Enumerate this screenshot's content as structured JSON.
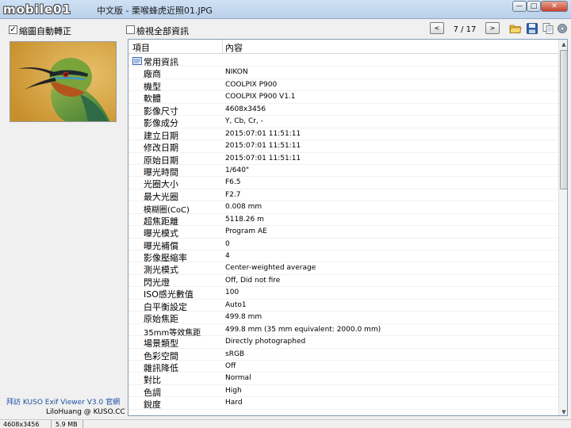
{
  "title_bar": {
    "logo_text": "mobile01",
    "window_title": "中文版 - 栗喉蜂虎近照01.JPG",
    "minimize_glyph": "—",
    "maximize_glyph": "□",
    "close_glyph": "✕"
  },
  "toolbar": {
    "auto_rotate_label": "縮圖自動轉正",
    "auto_rotate_checked": true,
    "check_glyph": "✓",
    "show_all_label": "檢視全部資訊",
    "show_all_checked": false,
    "prev_glyph": "<",
    "next_glyph": ">",
    "page_indicator": "7 / 17",
    "icons": [
      "folder-open-icon",
      "save-icon",
      "copy-icon",
      "settings-icon"
    ]
  },
  "table": {
    "headers": {
      "item": "項目",
      "value": "內容"
    },
    "group_label": "常用資訊",
    "rows": [
      {
        "key": "廠商",
        "value": "NIKON"
      },
      {
        "key": "機型",
        "value": "COOLPIX P900"
      },
      {
        "key": "軟體",
        "value": "COOLPIX P900   V1.1"
      },
      {
        "key": "影像尺寸",
        "value": "4608x3456"
      },
      {
        "key": "影像成分",
        "value": "Y, Cb, Cr, -"
      },
      {
        "key": "建立日期",
        "value": "2015:07:01 11:51:11"
      },
      {
        "key": "修改日期",
        "value": "2015:07:01 11:51:11"
      },
      {
        "key": "原始日期",
        "value": "2015:07:01 11:51:11"
      },
      {
        "key": "曝光時間",
        "value": "1/640\""
      },
      {
        "key": "光圈大小",
        "value": "F6.5"
      },
      {
        "key": "最大光圈",
        "value": "F2.7"
      },
      {
        "key": "模糊圈(CoC)",
        "value": "0.008 mm"
      },
      {
        "key": "超焦距離",
        "value": "5118.26 m"
      },
      {
        "key": "曝光模式",
        "value": "Program AE"
      },
      {
        "key": "曝光補償",
        "value": "0"
      },
      {
        "key": "影像壓縮率",
        "value": "4"
      },
      {
        "key": "測光模式",
        "value": "Center-weighted average"
      },
      {
        "key": "閃光燈",
        "value": "Off, Did not fire"
      },
      {
        "key": "ISO感光數值",
        "value": "100"
      },
      {
        "key": "白平衡設定",
        "value": "Auto1"
      },
      {
        "key": "原始焦距",
        "value": "499.8 mm"
      },
      {
        "key": "35mm等效焦距",
        "value": "499.8 mm (35 mm equivalent: 2000.0 mm)"
      },
      {
        "key": "場景類型",
        "value": "Directly photographed"
      },
      {
        "key": "色彩空間",
        "value": "sRGB"
      },
      {
        "key": "雜訊降低",
        "value": "Off"
      },
      {
        "key": "對比",
        "value": "Normal"
      },
      {
        "key": "色調",
        "value": "High"
      },
      {
        "key": "銳度",
        "value": "Hard"
      }
    ],
    "scroll_up_glyph": "▲",
    "scroll_down_glyph": "▼"
  },
  "sidebar": {
    "credit_line_1": "拜訪 KUSO Exif Viewer V3.0 官網",
    "credit_line_2": "LiloHuang @ KUSO.CC"
  },
  "status_bar": {
    "dimensions": "4608x3456",
    "file_size": "5.9 MB"
  },
  "colors": {
    "title_bar": "#c3d8ee",
    "credit_link": "#1f4fa3",
    "table_border": "#7f9db9"
  }
}
